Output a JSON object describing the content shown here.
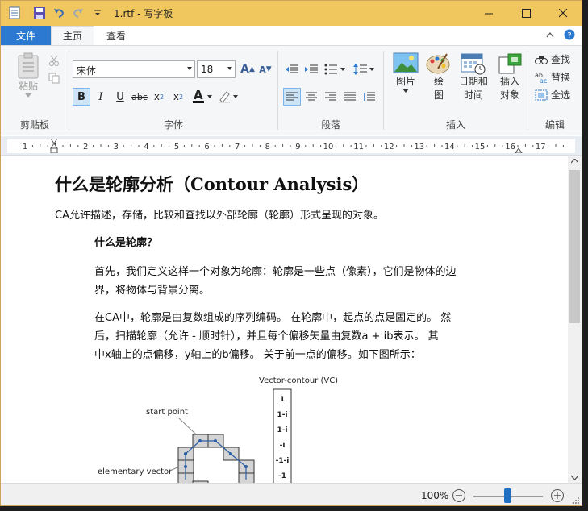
{
  "window": {
    "title": "1.rtf - 写字板"
  },
  "qat": {
    "icons": [
      "doc-icon",
      "save-icon",
      "undo-icon",
      "redo-icon",
      "customize-icon"
    ]
  },
  "tabs": [
    {
      "label": "文件"
    },
    {
      "label": "主页"
    },
    {
      "label": "查看"
    }
  ],
  "ribbon": {
    "clipboard": {
      "paste": "粘贴",
      "label": "剪贴板"
    },
    "font": {
      "family": "宋体",
      "size": "18",
      "label": "字体"
    },
    "paragraph": {
      "label": "段落"
    },
    "insert": {
      "picture": "图片",
      "paint_line1": "绘",
      "paint_line2": "图",
      "datetime_line1": "日期和",
      "datetime_line2": "时间",
      "object_line1": "插入",
      "object_line2": "对象",
      "label": "插入"
    },
    "editing": {
      "find": "查找",
      "replace": "替换",
      "select_all": "全选",
      "label": "编辑"
    }
  },
  "ruler": {
    "numbers": [
      "1",
      "1",
      "2",
      "3",
      "4",
      "5",
      "6",
      "7",
      "8",
      "9",
      "10",
      "11",
      "12",
      "13",
      "14",
      "15",
      "16",
      "17"
    ]
  },
  "document": {
    "title": "什么是轮廓分析（Contour Analysis）",
    "intro": "CA允许描述，存储，比较和查找以外部轮廓（轮廓）形式呈现的对象。",
    "heading": "什么是轮廓？",
    "p1_line1": "首先，我们定义这样一个对象为轮廓：轮廓是一些点（像素），它们是物体的边",
    "p1_line2": "界，将物体与背景分离。",
    "p2_line1": "在CA中，轮廓是由复数组成的序列编码。 在轮廓中，起点的点是固定的。 然",
    "p2_line2": "后，扫描轮廓（允许 - 顺时针），并且每个偏移矢量由复数a + ib表示。 其",
    "p2_line3": "中x轴上的点偏移，y轴上的b偏移。 关于前一点的偏移。如下图所示：",
    "figure": {
      "vc_title": "Vector-contour (VC)",
      "vc_values": [
        "1",
        "1-i",
        "1-i",
        "-i",
        "-1-i",
        "-1"
      ],
      "start_point": "start point",
      "elementary_vector": "elementary vector"
    }
  },
  "status": {
    "zoom": "100%",
    "zoom_level_percent": 100
  }
}
